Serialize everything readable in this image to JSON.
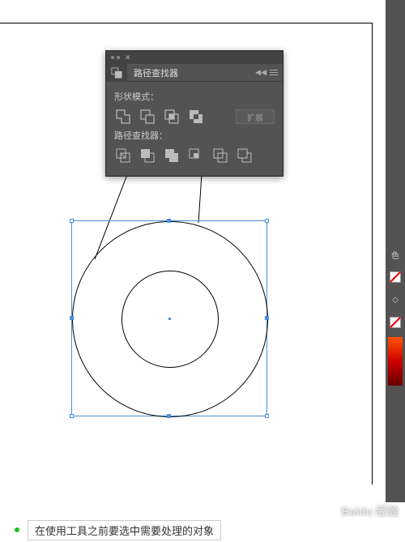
{
  "panel": {
    "title": "路径查找器",
    "shape_modes_label": "形状模式：",
    "pathfinders_label": "路径查找器：",
    "expand_label": "扩展"
  },
  "right_strip": {
    "swatch_label": "色",
    "divider_label": "◇"
  },
  "footer": {
    "tip": "在使用工具之前要选中需要处理的对象"
  },
  "watermark": "Baidu 经验"
}
